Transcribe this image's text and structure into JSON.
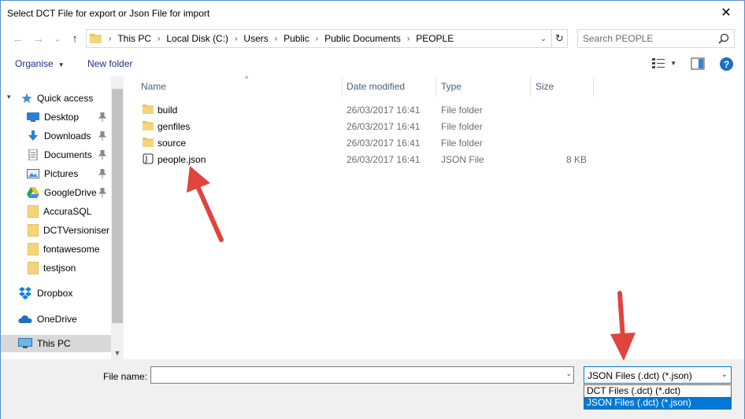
{
  "window": {
    "title": "Select DCT File for export or Json File for import",
    "close_glyph": "✕"
  },
  "nav": {
    "back_glyph": "←",
    "forward_glyph": "→",
    "recent_glyph": "⌄",
    "up_glyph": "↑",
    "breadcrumbs": [
      "This PC",
      "Local Disk (C:)",
      "Users",
      "Public",
      "Public Documents",
      "PEOPLE"
    ],
    "separator": "›",
    "dropdown_glyph": "⌄",
    "refresh_glyph": "↻",
    "search_placeholder": "Search PEOPLE"
  },
  "toolbar": {
    "organise_label": "Organise",
    "new_folder_label": "New folder",
    "help_glyph": "?"
  },
  "sidebar": {
    "quick_access": "Quick access",
    "pinned": [
      {
        "label": "Desktop",
        "icon": "desktop-icon"
      },
      {
        "label": "Downloads",
        "icon": "downloads-icon"
      },
      {
        "label": "Documents",
        "icon": "documents-icon"
      },
      {
        "label": "Pictures",
        "icon": "pictures-icon"
      },
      {
        "label": "GoogleDrive",
        "icon": "googledrive-icon"
      }
    ],
    "folders": [
      "AccuraSQL",
      "DCTVersioniser",
      "fontawesome",
      "testjson"
    ],
    "dropbox": "Dropbox",
    "onedrive": "OneDrive",
    "thispc": "This PC"
  },
  "filelist": {
    "columns": {
      "name": "Name",
      "date": "Date modified",
      "type": "Type",
      "size": "Size"
    },
    "rows": [
      {
        "name": "build",
        "date": "26/03/2017 16:41",
        "type": "File folder",
        "size": "",
        "icon": "folder-icon"
      },
      {
        "name": "genfiles",
        "date": "26/03/2017 16:41",
        "type": "File folder",
        "size": "",
        "icon": "folder-icon"
      },
      {
        "name": "source",
        "date": "26/03/2017 16:41",
        "type": "File folder",
        "size": "",
        "icon": "folder-icon"
      },
      {
        "name": "people.json",
        "date": "26/03/2017 16:41",
        "type": "JSON File",
        "size": "8 KB",
        "icon": "json-file-icon"
      }
    ]
  },
  "bottom": {
    "filename_label": "File name:",
    "filename_value": "",
    "filetype_selected": "JSON Files (.dct) (*.json)",
    "filetype_options": [
      "DCT Files (.dct) (*.dct)",
      "JSON Files (.dct) (*.json)"
    ],
    "selected_option_index": 1
  },
  "colors": {
    "accent": "#0078d7",
    "folder": "#e8c35a",
    "annotation_arrow": "#e0443e"
  }
}
